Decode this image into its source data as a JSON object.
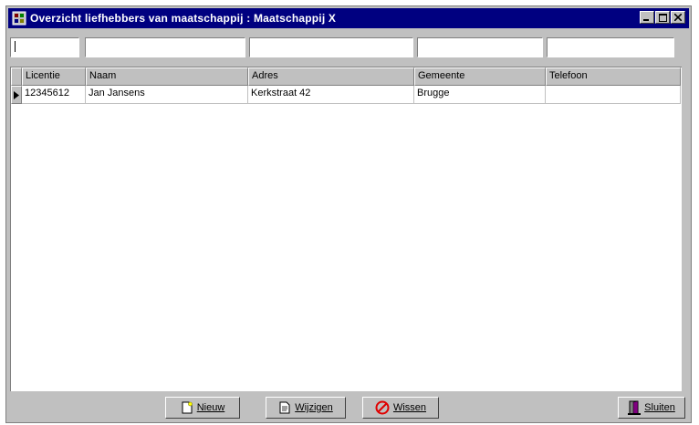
{
  "window": {
    "title": "Overzicht liefhebbers van maatschappij : Maatschappij X"
  },
  "filters": {
    "licentie": "",
    "naam": "",
    "adres": "",
    "gemeente": "",
    "telefoon": ""
  },
  "table": {
    "columns": [
      "Licentie",
      "Naam",
      "Adres",
      "Gemeente",
      "Telefoon"
    ],
    "rows": [
      [
        "12345612",
        "Jan Jansens",
        "Kerkstraat 42",
        "Brugge",
        ""
      ]
    ]
  },
  "buttons": {
    "nieuw": "Nieuw",
    "wijzigen": "Wijzigen",
    "wissen": "Wissen",
    "sluiten": "Sluiten"
  },
  "colors": {
    "titlebar": "#000080",
    "face": "#c0c0c0"
  }
}
